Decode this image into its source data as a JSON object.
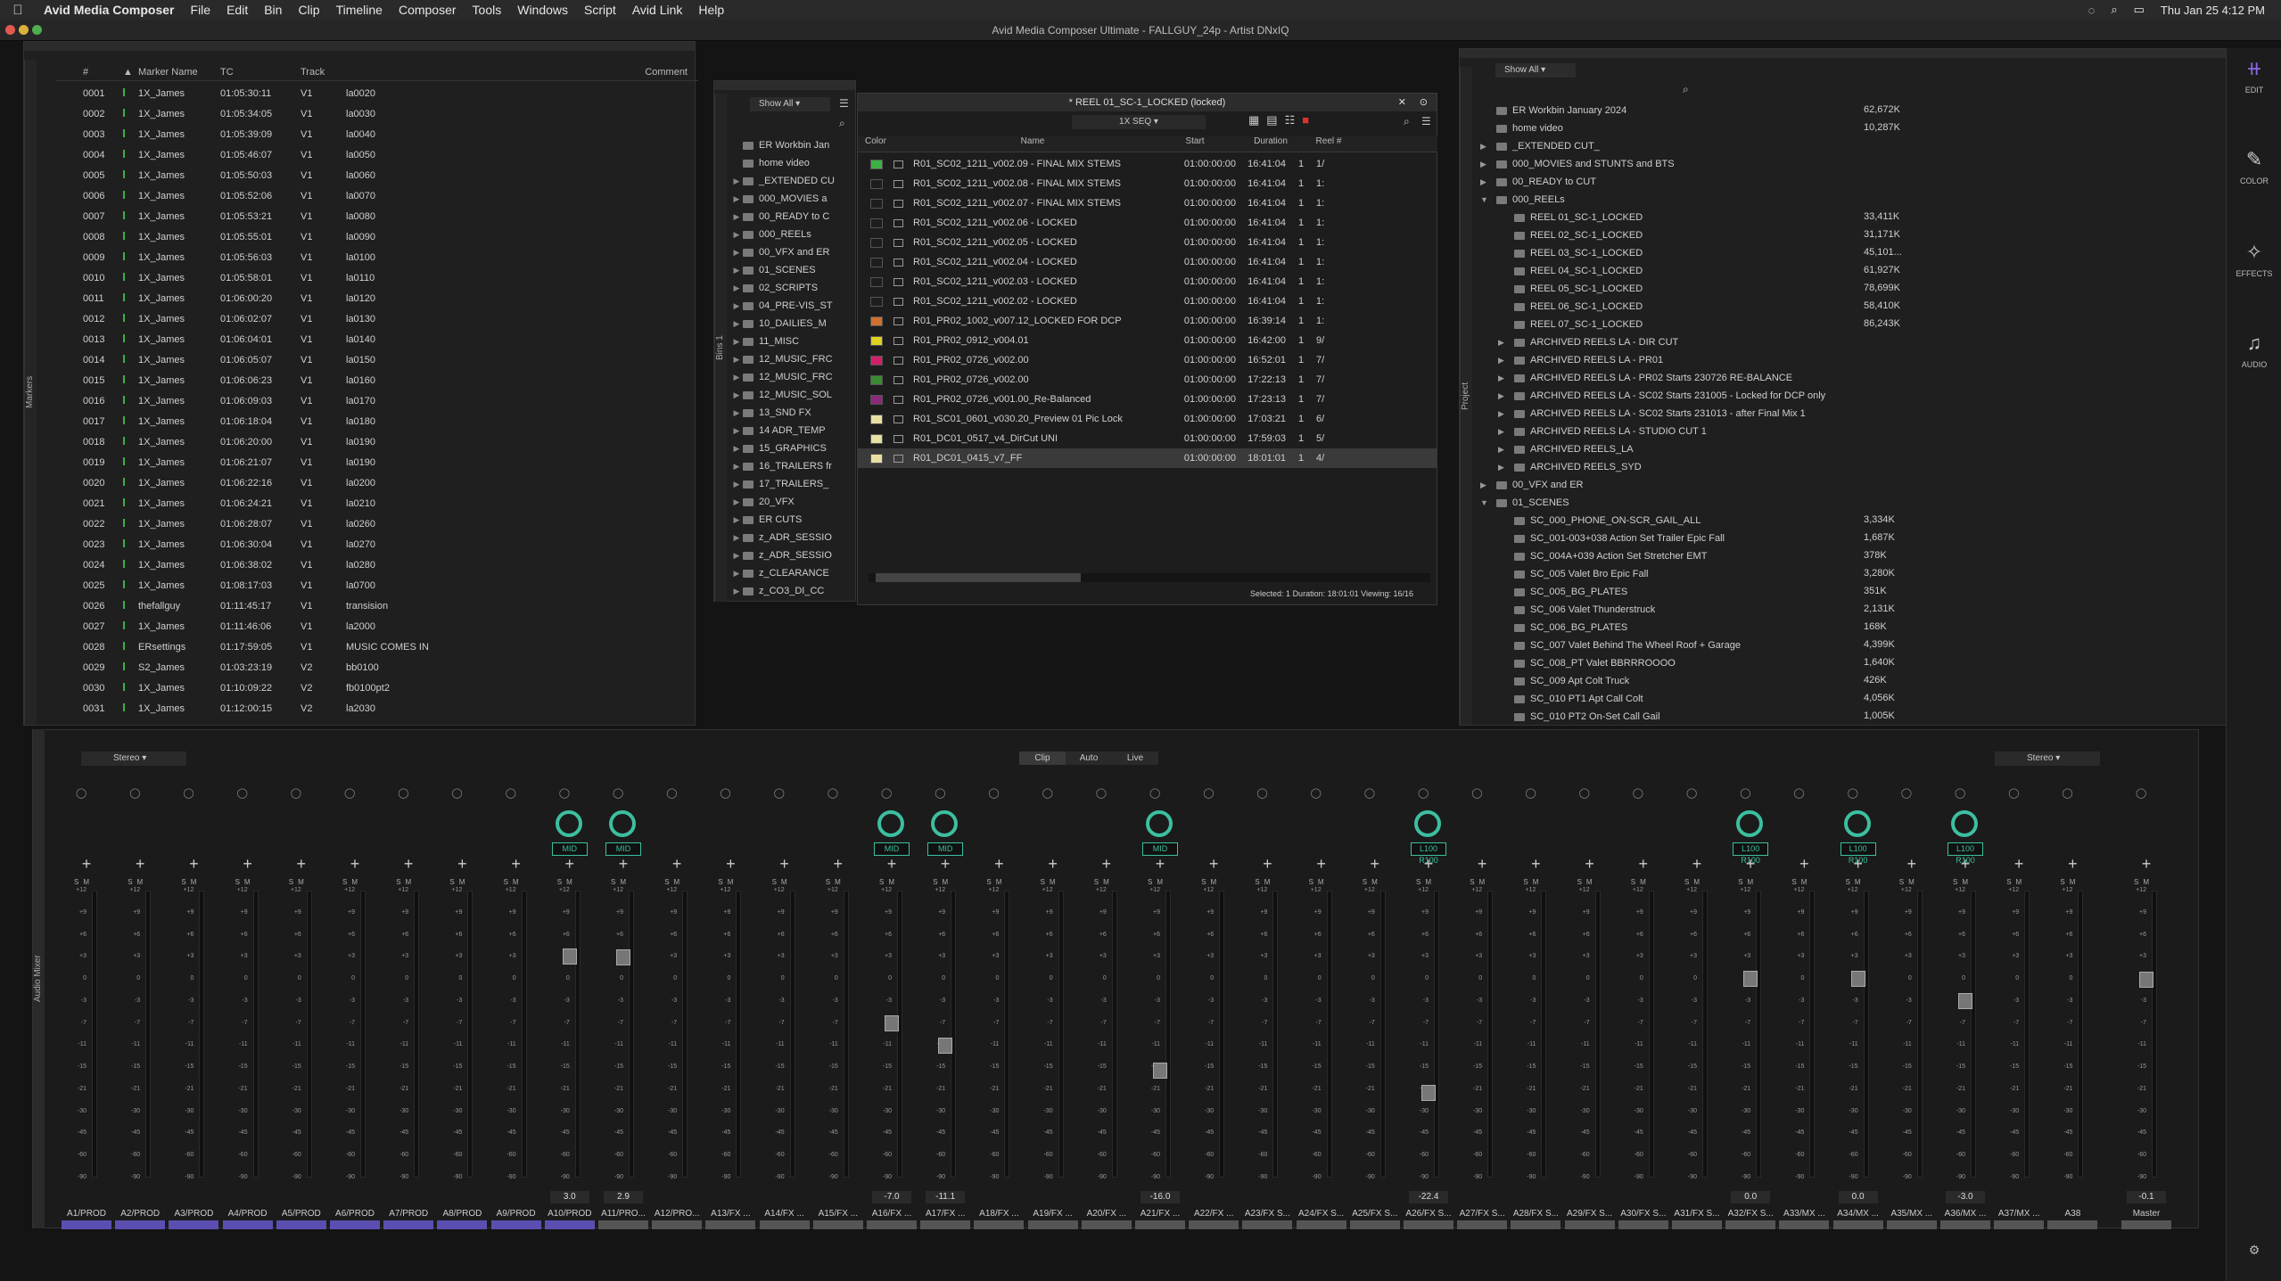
{
  "menubar": {
    "apple": "",
    "items": [
      "Avid Media Composer",
      "File",
      "Edit",
      "Bin",
      "Clip",
      "Timeline",
      "Composer",
      "Tools",
      "Windows",
      "Script",
      "Avid Link",
      "Help"
    ],
    "clock": "Thu Jan 25  4:12 PM"
  },
  "titlebar": "Avid Media Composer Ultimate - FALLGUY_24p - Artist DNxIQ",
  "markers": {
    "tab": "Markers",
    "headers": [
      "#",
      "Marker Name",
      "TC",
      "Track",
      "Comment"
    ],
    "rows": [
      [
        "0001",
        "1X_James",
        "01:05:30:11",
        "V1",
        "la0020"
      ],
      [
        "0002",
        "1X_James",
        "01:05:34:05",
        "V1",
        "la0030"
      ],
      [
        "0003",
        "1X_James",
        "01:05:39:09",
        "V1",
        "la0040"
      ],
      [
        "0004",
        "1X_James",
        "01:05:46:07",
        "V1",
        "la0050"
      ],
      [
        "0005",
        "1X_James",
        "01:05:50:03",
        "V1",
        "la0060"
      ],
      [
        "0006",
        "1X_James",
        "01:05:52:06",
        "V1",
        "la0070"
      ],
      [
        "0007",
        "1X_James",
        "01:05:53:21",
        "V1",
        "la0080"
      ],
      [
        "0008",
        "1X_James",
        "01:05:55:01",
        "V1",
        "la0090"
      ],
      [
        "0009",
        "1X_James",
        "01:05:56:03",
        "V1",
        "la0100"
      ],
      [
        "0010",
        "1X_James",
        "01:05:58:01",
        "V1",
        "la0110"
      ],
      [
        "0011",
        "1X_James",
        "01:06:00:20",
        "V1",
        "la0120"
      ],
      [
        "0012",
        "1X_James",
        "01:06:02:07",
        "V1",
        "la0130"
      ],
      [
        "0013",
        "1X_James",
        "01:06:04:01",
        "V1",
        "la0140"
      ],
      [
        "0014",
        "1X_James",
        "01:06:05:07",
        "V1",
        "la0150"
      ],
      [
        "0015",
        "1X_James",
        "01:06:06:23",
        "V1",
        "la0160"
      ],
      [
        "0016",
        "1X_James",
        "01:06:09:03",
        "V1",
        "la0170"
      ],
      [
        "0017",
        "1X_James",
        "01:06:18:04",
        "V1",
        "la0180"
      ],
      [
        "0018",
        "1X_James",
        "01:06:20:00",
        "V1",
        "la0190"
      ],
      [
        "0019",
        "1X_James",
        "01:06:21:07",
        "V1",
        "la0190"
      ],
      [
        "0020",
        "1X_James",
        "01:06:22:16",
        "V1",
        "la0200"
      ],
      [
        "0021",
        "1X_James",
        "01:06:24:21",
        "V1",
        "la0210"
      ],
      [
        "0022",
        "1X_James",
        "01:06:28:07",
        "V1",
        "la0260"
      ],
      [
        "0023",
        "1X_James",
        "01:06:30:04",
        "V1",
        "la0270"
      ],
      [
        "0024",
        "1X_James",
        "01:06:38:02",
        "V1",
        "la0280"
      ],
      [
        "0025",
        "1X_James",
        "01:08:17:03",
        "V1",
        "la0700"
      ],
      [
        "0026",
        "thefallguy",
        "01:11:45:17",
        "V1",
        "transision"
      ],
      [
        "0027",
        "1X_James",
        "01:11:46:06",
        "V1",
        "la2000"
      ],
      [
        "0028",
        "ERsettings",
        "01:17:59:05",
        "V1",
        "MUSIC COMES IN"
      ],
      [
        "0029",
        "S2_James",
        "01:03:23:19",
        "V2",
        "bb0100"
      ],
      [
        "0030",
        "1X_James",
        "01:10:09:22",
        "V2",
        "fb0100pt2"
      ],
      [
        "0031",
        "1X_James",
        "01:12:00:15",
        "V2",
        "la2030"
      ]
    ]
  },
  "bins": {
    "tab": "Bins 1",
    "show": "Show All",
    "items": [
      "ER Workbin Jan",
      "home video",
      "_EXTENDED CU",
      "000_MOVIES a",
      "00_READY to C",
      "000_REELs",
      "00_VFX and ER",
      "01_SCENES",
      "02_SCRIPTS",
      "04_PRE-VIS_ST",
      "10_DAILIES_M",
      "11_MISC",
      "12_MUSIC_FRC",
      "12_MUSIC_FRC",
      "12_MUSIC_SOL",
      "13_SND FX",
      "14 ADR_TEMP",
      "15_GRAPHICS",
      "16_TRAILERS fr",
      "17_TRAILERS_",
      "20_VFX",
      "ER CUTS",
      "z_ADR_SESSIO",
      "z_ADR_SESSIO",
      "z_CLEARANCE",
      "z_CO3_DI_CC"
    ]
  },
  "reel": {
    "title": "* REEL 01_SC-1_LOCKED (locked)",
    "view": "1X SEQ",
    "headers": [
      "Color",
      "Name",
      "Start",
      "Duration",
      "Reel #"
    ],
    "rows": [
      {
        "color": "#3cb043",
        "name": "R01_SC02_1211_v002.09 - FINAL MIX STEMS",
        "start": "01:00:00:00",
        "dur": "16:41:04",
        "reel": "1",
        "extra": "1/"
      },
      {
        "color": "",
        "name": "R01_SC02_1211_v002.08 - FINAL MIX STEMS",
        "start": "01:00:00:00",
        "dur": "16:41:04",
        "reel": "1",
        "extra": "1:"
      },
      {
        "color": "",
        "name": "R01_SC02_1211_v002.07 - FINAL MIX STEMS",
        "start": "01:00:00:00",
        "dur": "16:41:04",
        "reel": "1",
        "extra": "1:"
      },
      {
        "color": "",
        "name": "R01_SC02_1211_v002.06 - LOCKED",
        "start": "01:00:00:00",
        "dur": "16:41:04",
        "reel": "1",
        "extra": "1:"
      },
      {
        "color": "",
        "name": "R01_SC02_1211_v002.05 - LOCKED",
        "start": "01:00:00:00",
        "dur": "16:41:04",
        "reel": "1",
        "extra": "1:"
      },
      {
        "color": "",
        "name": "R01_SC02_1211_v002.04 - LOCKED",
        "start": "01:00:00:00",
        "dur": "16:41:04",
        "reel": "1",
        "extra": "1:"
      },
      {
        "color": "",
        "name": "R01_SC02_1211_v002.03 - LOCKED",
        "start": "01:00:00:00",
        "dur": "16:41:04",
        "reel": "1",
        "extra": "1:"
      },
      {
        "color": "",
        "name": "R01_SC02_1211_v002.02 - LOCKED",
        "start": "01:00:00:00",
        "dur": "16:41:04",
        "reel": "1",
        "extra": "1:"
      },
      {
        "color": "#d07030",
        "name": "R01_PR02_1002_v007.12_LOCKED FOR DCP",
        "start": "01:00:00:00",
        "dur": "16:39:14",
        "reel": "1",
        "extra": "1:"
      },
      {
        "color": "#e0d020",
        "name": "R01_PR02_0912_v004.01",
        "start": "01:00:00:00",
        "dur": "16:42:00",
        "reel": "1",
        "extra": "9/"
      },
      {
        "color": "#d0206a",
        "name": "R01_PR02_0726_v002.00",
        "start": "01:00:00:00",
        "dur": "16:52:01",
        "reel": "1",
        "extra": "7/"
      },
      {
        "color": "#3a8a30",
        "name": "R01_PR02_0726_v002.00",
        "start": "01:00:00:00",
        "dur": "17:22:13",
        "reel": "1",
        "extra": "7/"
      },
      {
        "color": "#8a2a7a",
        "name": "R01_PR02_0726_v001.00_Re-Balanced",
        "start": "01:00:00:00",
        "dur": "17:23:13",
        "reel": "1",
        "extra": "7/"
      },
      {
        "color": "#e8e0a0",
        "name": "R01_SC01_0601_v030.20_Preview 01 Pic Lock",
        "start": "01:00:00:00",
        "dur": "17:03:21",
        "reel": "1",
        "extra": "6/"
      },
      {
        "color": "#e8e0a0",
        "name": "R01_DC01_0517_v4_DirCut UNI",
        "start": "01:00:00:00",
        "dur": "17:59:03",
        "reel": "1",
        "extra": "5/"
      },
      {
        "color": "#e8e0a0",
        "name": "R01_DC01_0415_v7_FF",
        "start": "01:00:00:00",
        "dur": "18:01:01",
        "reel": "1",
        "extra": "4/"
      }
    ],
    "status": "Selected: 1  Duration: 18:01:01   Viewing: 16/16"
  },
  "project": {
    "tab": "Project",
    "show": "Show All",
    "rows": [
      {
        "ind": 0,
        "tri": "",
        "name": "ER Workbin January 2024",
        "size": "62,672K"
      },
      {
        "ind": 0,
        "tri": "",
        "name": "home video",
        "size": "10,287K"
      },
      {
        "ind": 0,
        "tri": "▶",
        "name": "_EXTENDED CUT_",
        "size": ""
      },
      {
        "ind": 0,
        "tri": "▶",
        "name": "000_MOVIES and STUNTS and BTS",
        "size": ""
      },
      {
        "ind": 0,
        "tri": "▶",
        "name": "00_READY to CUT",
        "size": ""
      },
      {
        "ind": 0,
        "tri": "▼",
        "name": "000_REELs",
        "size": ""
      },
      {
        "ind": 1,
        "tri": "",
        "name": "REEL 01_SC-1_LOCKED",
        "size": "33,411K"
      },
      {
        "ind": 1,
        "tri": "",
        "name": "REEL 02_SC-1_LOCKED",
        "size": "31,171K"
      },
      {
        "ind": 1,
        "tri": "",
        "name": "REEL 03_SC-1_LOCKED",
        "size": "45,101..."
      },
      {
        "ind": 1,
        "tri": "",
        "name": "REEL 04_SC-1_LOCKED",
        "size": "61,927K"
      },
      {
        "ind": 1,
        "tri": "",
        "name": "REEL 05_SC-1_LOCKED",
        "size": "78,699K"
      },
      {
        "ind": 1,
        "tri": "",
        "name": "REEL 06_SC-1_LOCKED",
        "size": "58,410K"
      },
      {
        "ind": 1,
        "tri": "",
        "name": "REEL 07_SC-1_LOCKED",
        "size": "86,243K"
      },
      {
        "ind": 1,
        "tri": "▶",
        "name": "ARCHIVED REELS LA - DIR CUT",
        "size": ""
      },
      {
        "ind": 1,
        "tri": "▶",
        "name": "ARCHIVED REELS LA - PR01",
        "size": ""
      },
      {
        "ind": 1,
        "tri": "▶",
        "name": "ARCHIVED REELS LA - PR02 Starts 230726 RE-BALANCE",
        "size": ""
      },
      {
        "ind": 1,
        "tri": "▶",
        "name": "ARCHIVED REELS LA - SC02 Starts 231005 - Locked for DCP only",
        "size": ""
      },
      {
        "ind": 1,
        "tri": "▶",
        "name": "ARCHIVED REELS LA - SC02 Starts 231013 - after Final Mix 1",
        "size": ""
      },
      {
        "ind": 1,
        "tri": "▶",
        "name": "ARCHIVED REELS LA - STUDIO CUT 1",
        "size": ""
      },
      {
        "ind": 1,
        "tri": "▶",
        "name": "ARCHIVED REELS_LA",
        "size": ""
      },
      {
        "ind": 1,
        "tri": "▶",
        "name": "ARCHIVED REELS_SYD",
        "size": ""
      },
      {
        "ind": 0,
        "tri": "▶",
        "name": "00_VFX and ER",
        "size": ""
      },
      {
        "ind": 0,
        "tri": "▼",
        "name": "01_SCENES",
        "size": ""
      },
      {
        "ind": 1,
        "tri": "",
        "name": "SC_000_PHONE_ON-SCR_GAIL_ALL",
        "size": "3,334K"
      },
      {
        "ind": 1,
        "tri": "",
        "name": "SC_001-003+038 Action Set Trailer Epic Fall",
        "size": "1,687K"
      },
      {
        "ind": 1,
        "tri": "",
        "name": "SC_004A+039 Action Set Stretcher EMT",
        "size": "378K"
      },
      {
        "ind": 1,
        "tri": "",
        "name": "SC_005 Valet Bro Epic Fall",
        "size": "3,280K"
      },
      {
        "ind": 1,
        "tri": "",
        "name": "SC_005_BG_PLATES",
        "size": "351K"
      },
      {
        "ind": 1,
        "tri": "",
        "name": "SC_006 Valet Thunderstruck",
        "size": "2,131K"
      },
      {
        "ind": 1,
        "tri": "",
        "name": "SC_006_BG_PLATES",
        "size": "168K"
      },
      {
        "ind": 1,
        "tri": "",
        "name": "SC_007 Valet Behind The Wheel Roof + Garage",
        "size": "4,399K"
      },
      {
        "ind": 1,
        "tri": "",
        "name": "SC_008_PT Valet BBRRROOOO",
        "size": "1,640K"
      },
      {
        "ind": 1,
        "tri": "",
        "name": "SC_009 Apt Colt Truck",
        "size": "426K"
      },
      {
        "ind": 1,
        "tri": "",
        "name": "SC_010 PT1 Apt Call Colt",
        "size": "4,056K"
      },
      {
        "ind": 1,
        "tri": "",
        "name": "SC_010 PT2 On-Set Call Gail",
        "size": "1,005K"
      }
    ]
  },
  "toolbar": {
    "edit": "EDIT",
    "color": "COLOR",
    "effects": "EFFECTS",
    "audio": "AUDIO"
  },
  "mixer": {
    "tab": "Audio Mixer",
    "mode": "Stereo",
    "mode_right": "Stereo",
    "tabs": [
      "Clip",
      "Auto",
      "Live"
    ],
    "scale": [
      "+12",
      "+9",
      "+6",
      "+3",
      "0",
      "-3",
      "-7",
      "-11",
      "-15",
      "-21",
      "-30",
      "-45",
      "-60",
      "-90"
    ],
    "strips": [
      {
        "label": "A1/PROD",
        "pan": "",
        "val": "",
        "fader": null,
        "bar": "#5a4fb0"
      },
      {
        "label": "A2/PROD",
        "pan": "",
        "val": "",
        "fader": null,
        "bar": "#5a4fb0"
      },
      {
        "label": "A3/PROD",
        "pan": "",
        "val": "",
        "fader": null,
        "bar": "#5a4fb0"
      },
      {
        "label": "A4/PROD",
        "pan": "",
        "val": "",
        "fader": null,
        "bar": "#5a4fb0"
      },
      {
        "label": "A5/PROD",
        "pan": "",
        "val": "",
        "fader": null,
        "bar": "#5a4fb0"
      },
      {
        "label": "A6/PROD",
        "pan": "",
        "val": "",
        "fader": null,
        "bar": "#5a4fb0"
      },
      {
        "label": "A7/PROD",
        "pan": "",
        "val": "",
        "fader": null,
        "bar": "#5a4fb0"
      },
      {
        "label": "A8/PROD",
        "pan": "",
        "val": "",
        "fader": null,
        "bar": "#5a4fb0"
      },
      {
        "label": "A9/PROD",
        "pan": "",
        "val": "",
        "fader": null,
        "bar": "#5a4fb0"
      },
      {
        "label": "A10/PROD",
        "pan": "MID",
        "val": "3.0",
        "fader": 3.0,
        "bar": "#5a4fb0"
      },
      {
        "label": "A11/PRO...",
        "pan": "MID",
        "val": "2.9",
        "fader": 2.9,
        "bar": "#555"
      },
      {
        "label": "A12/PRO...",
        "pan": "",
        "val": "",
        "fader": null,
        "bar": "#555"
      },
      {
        "label": "A13/FX ...",
        "pan": "",
        "val": "",
        "fader": null,
        "bar": "#555"
      },
      {
        "label": "A14/FX ...",
        "pan": "",
        "val": "",
        "fader": null,
        "bar": "#555"
      },
      {
        "label": "A15/FX ...",
        "pan": "",
        "val": "",
        "fader": null,
        "bar": "#555"
      },
      {
        "label": "A16/FX ...",
        "pan": "MID",
        "val": "-7.0",
        "fader": -7.0,
        "bar": "#555"
      },
      {
        "label": "A17/FX ...",
        "pan": "MID",
        "val": "-11.1",
        "fader": -11.1,
        "bar": "#555"
      },
      {
        "label": "A18/FX ...",
        "pan": "",
        "val": "",
        "fader": null,
        "bar": "#555"
      },
      {
        "label": "A19/FX ...",
        "pan": "",
        "val": "",
        "fader": null,
        "bar": "#555"
      },
      {
        "label": "A20/FX ...",
        "pan": "",
        "val": "",
        "fader": null,
        "bar": "#555"
      },
      {
        "label": "A21/FX ...",
        "pan": "MID",
        "val": "-16.0",
        "fader": -16.0,
        "bar": "#555"
      },
      {
        "label": "A22/FX ...",
        "pan": "",
        "val": "",
        "fader": null,
        "bar": "#555"
      },
      {
        "label": "A23/FX S...",
        "pan": "",
        "val": "",
        "fader": null,
        "bar": "#555"
      },
      {
        "label": "A24/FX S...",
        "pan": "",
        "val": "",
        "fader": null,
        "bar": "#555"
      },
      {
        "label": "A25/FX S...",
        "pan": "",
        "val": "",
        "fader": null,
        "bar": "#555"
      },
      {
        "label": "A26/FX S...",
        "pan": "L100 R100",
        "val": "-22.4",
        "fader": -22.4,
        "bar": "#555"
      },
      {
        "label": "A27/FX S...",
        "pan": "",
        "val": "",
        "fader": null,
        "bar": "#555"
      },
      {
        "label": "A28/FX S...",
        "pan": "",
        "val": "",
        "fader": null,
        "bar": "#555"
      },
      {
        "label": "A29/FX S...",
        "pan": "",
        "val": "",
        "fader": null,
        "bar": "#555"
      },
      {
        "label": "A30/FX S...",
        "pan": "",
        "val": "",
        "fader": null,
        "bar": "#555"
      },
      {
        "label": "A31/FX S...",
        "pan": "",
        "val": "",
        "fader": null,
        "bar": "#555"
      },
      {
        "label": "A32/FX S...",
        "pan": "L100 R100",
        "val": "0.0",
        "fader": 0.0,
        "bar": "#555"
      },
      {
        "label": "A33/MX ...",
        "pan": "",
        "val": "",
        "fader": null,
        "bar": "#555"
      },
      {
        "label": "A34/MX ...",
        "pan": "L100 R100",
        "val": "0.0",
        "fader": 0.0,
        "bar": "#555"
      },
      {
        "label": "A35/MX ...",
        "pan": "",
        "val": "",
        "fader": null,
        "bar": "#555"
      },
      {
        "label": "A36/MX ...",
        "pan": "L100 R100",
        "val": "-3.0",
        "fader": -3.0,
        "bar": "#555"
      },
      {
        "label": "A37/MX ...",
        "pan": "",
        "val": "",
        "fader": null,
        "bar": "#555"
      },
      {
        "label": "A38",
        "pan": "",
        "val": "",
        "fader": null,
        "bar": "#555"
      },
      {
        "label": "Master",
        "pan": "",
        "val": "-0.1",
        "fader": -0.1,
        "bar": "#555"
      }
    ]
  }
}
